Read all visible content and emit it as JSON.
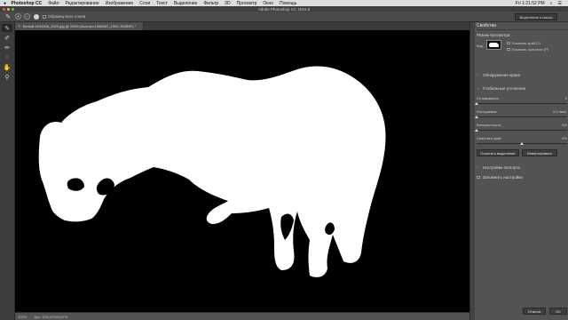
{
  "menubar": {
    "apple": "",
    "items": [
      "Photoshop CC",
      "Файл",
      "Редактирование",
      "Изображение",
      "Слои",
      "Текст",
      "Выделение",
      "Фильтр",
      "3D",
      "Просмотр",
      "Окно",
      "Помощь"
    ],
    "clock": "Fri 1:21:52 PM"
  },
  "window": {
    "title": "Adobe Photoshop CC 2015.5"
  },
  "optbar": {
    "sample_all_layers": "Образец всех слоев",
    "workspace": "Выделение и маска"
  },
  "document": {
    "tab_title": "Белый-1615348_1920.jpg @ 100% (Быстро-1566657_1920, RGB/8*) *"
  },
  "statusbar": {
    "zoom": "100%",
    "doc": "Док: 10/6,67M/9,67M"
  },
  "panel": {
    "title": "Свойства",
    "view_mode_label": "Режим просмотра",
    "view_label": "Вид:",
    "show_edge": "Показать край (J)",
    "show_original": "Показать оригинал (P)",
    "edge_detection": "Обнаружение краев",
    "global_refinements": "Глобальные уточнения",
    "sliders": [
      {
        "label": "Сглаживание:",
        "value": "0",
        "fraction": 0.0
      },
      {
        "label": "Растушевка:",
        "value": "0,0 пикс.",
        "fraction": 0.0
      },
      {
        "label": "Контрастность:",
        "value": "0%",
        "fraction": 0.0
      },
      {
        "label": "Сместить край:",
        "value": "0%",
        "fraction": 0.5
      }
    ],
    "clear_selection": "Очистить выделение",
    "invert": "Инвертировать",
    "output_settings": "Настройки экспорта",
    "remember_settings": "Запомнить настройки",
    "cancel": "Отмена",
    "ok": "OK"
  }
}
